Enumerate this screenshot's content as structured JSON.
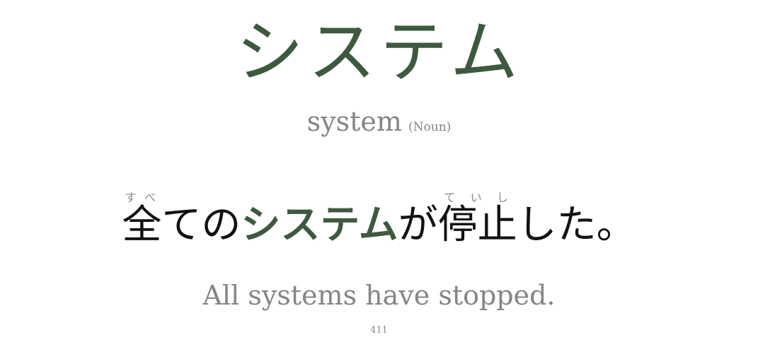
{
  "headword": "システム",
  "meaning": "system",
  "part_of_speech": "(Noun)",
  "sentence": {
    "seg1_kanji": "全",
    "seg1_reading": "すべ",
    "seg2": "ての",
    "target": "システム",
    "seg3": "が",
    "seg4_kanji": "停止",
    "seg4_reading": "ていし",
    "seg5": "した。"
  },
  "translation": "All systems have stopped.",
  "card_number": "411",
  "colors": {
    "accent": "#3d5a3f",
    "muted": "#858585",
    "text": "#111111"
  }
}
